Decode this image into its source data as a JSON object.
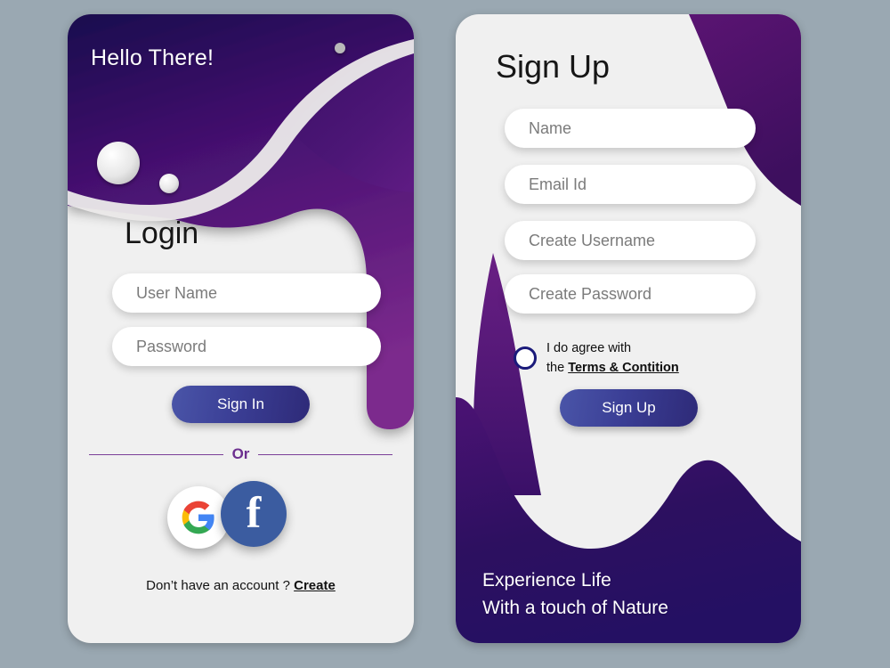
{
  "theme": {
    "page_background": "#9aa8b2",
    "card_background": "#f0f0f0",
    "purple_dark": "#1d0b52",
    "purple_mid": "#4a1273",
    "purple_light": "#7b2b8c",
    "accent_button_start": "#4a55a8",
    "accent_button_end": "#2e2a78",
    "divider_purple": "#7b3f98",
    "facebook_blue": "#3b5ca0",
    "radio_border": "#1a1a7a"
  },
  "login_card": {
    "greeting": "Hello There!",
    "title": "Login",
    "fields": [
      {
        "name": "username",
        "placeholder": "User Name",
        "value": ""
      },
      {
        "name": "password",
        "placeholder": "Password",
        "value": ""
      }
    ],
    "submit_label": "Sign In",
    "divider_label": "Or",
    "social": [
      {
        "name": "google-icon",
        "label": "G"
      },
      {
        "name": "facebook-icon",
        "label": "f"
      }
    ],
    "footer_prompt": "Don’t have an account ? ",
    "footer_link": "Create"
  },
  "signup_card": {
    "title": "Sign Up",
    "fields": [
      {
        "name": "name",
        "placeholder": "Name",
        "value": ""
      },
      {
        "name": "email",
        "placeholder": "Email Id",
        "value": ""
      },
      {
        "name": "create-username",
        "placeholder": "Create Username",
        "value": ""
      },
      {
        "name": "create-password",
        "placeholder": "Create Password",
        "value": ""
      }
    ],
    "agree_line1": "I do agree with",
    "agree_line2_prefix": "the ",
    "agree_terms_link": "Terms & Contition",
    "agree_checked": false,
    "submit_label": "Sign Up",
    "tagline_line1": "Experience Life",
    "tagline_line2": "With a touch of Nature"
  }
}
